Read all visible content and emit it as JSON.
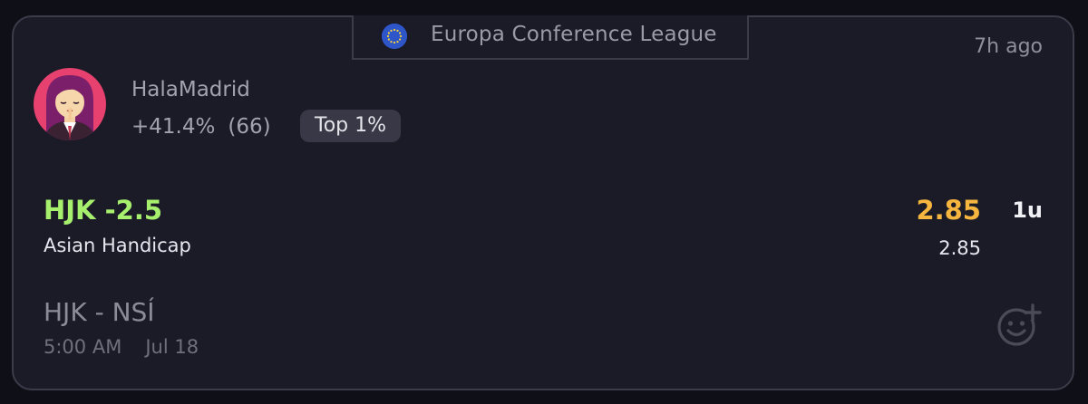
{
  "league": {
    "flag_icon": "eu-flag-icon",
    "name": "Europa Conference League"
  },
  "post": {
    "time_ago": "7h ago"
  },
  "user": {
    "avatar_icon": "avatar-icon",
    "name": "HalaMadrid",
    "roi": "+41.4%",
    "count": "(66)",
    "badge": "Top 1%"
  },
  "bet": {
    "pick": "HJK -2.5",
    "market": "Asian Handicap",
    "odds": "2.85",
    "stake": "1u",
    "odds_sub": "2.85"
  },
  "match": {
    "teams": "HJK - NSÍ",
    "time": "5:00 AM",
    "date": "Jul 18"
  },
  "actions": {
    "react_icon": "add-reaction-icon"
  },
  "colors": {
    "pick": "#a6f06d",
    "odds": "#f5b53e",
    "card_bg": "#1b1b27",
    "border": "#3b3b4a"
  }
}
